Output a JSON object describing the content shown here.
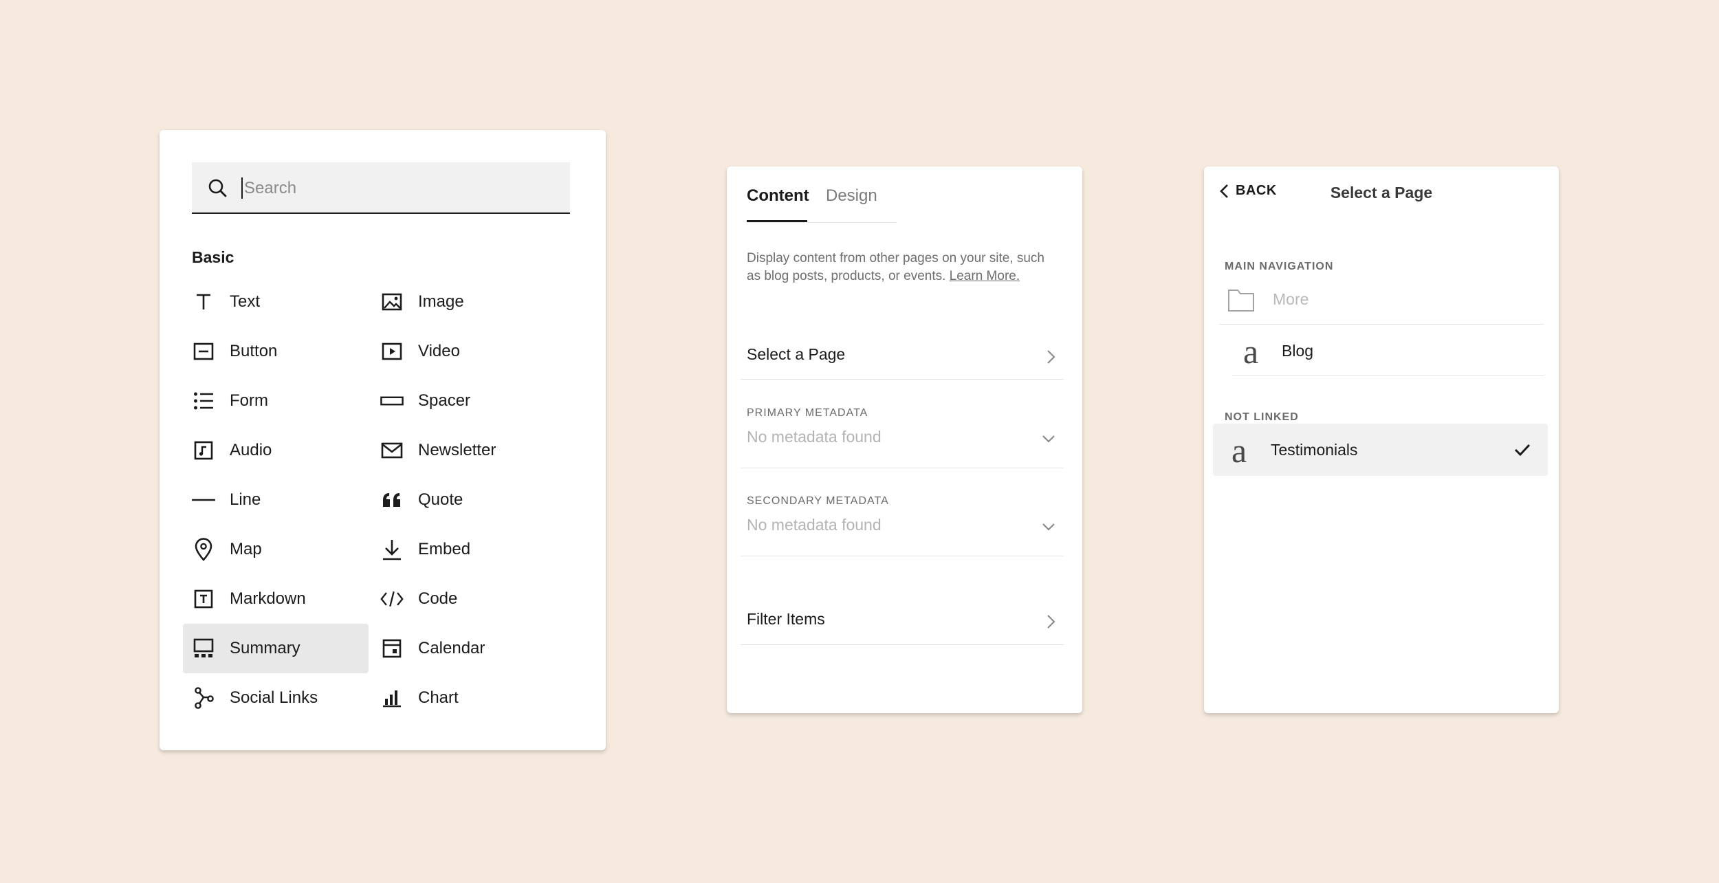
{
  "blocks_panel": {
    "search_placeholder": "Search",
    "section_title": "Basic",
    "left_column": [
      {
        "label": "Text",
        "icon": "text-icon"
      },
      {
        "label": "Button",
        "icon": "button-icon"
      },
      {
        "label": "Form",
        "icon": "form-icon"
      },
      {
        "label": "Audio",
        "icon": "audio-icon"
      },
      {
        "label": "Line",
        "icon": "line-icon"
      },
      {
        "label": "Map",
        "icon": "map-pin-icon"
      },
      {
        "label": "Markdown",
        "icon": "markdown-icon"
      },
      {
        "label": "Summary",
        "icon": "summary-icon",
        "selected": true
      },
      {
        "label": "Social Links",
        "icon": "social-links-icon"
      }
    ],
    "right_column": [
      {
        "label": "Image",
        "icon": "image-icon"
      },
      {
        "label": "Video",
        "icon": "video-icon"
      },
      {
        "label": "Spacer",
        "icon": "spacer-icon"
      },
      {
        "label": "Newsletter",
        "icon": "newsletter-icon"
      },
      {
        "label": "Quote",
        "icon": "quote-icon"
      },
      {
        "label": "Embed",
        "icon": "embed-icon"
      },
      {
        "label": "Code",
        "icon": "code-icon"
      },
      {
        "label": "Calendar",
        "icon": "calendar-icon"
      },
      {
        "label": "Chart",
        "icon": "chart-icon"
      }
    ]
  },
  "summary_panel": {
    "tabs": [
      {
        "label": "Content",
        "active": true
      },
      {
        "label": "Design",
        "active": false
      }
    ],
    "description": "Display content from other pages on your site, such as blog posts, products, or events.",
    "learn_more": "Learn More.",
    "select_page": "Select a Page",
    "primary_metadata": {
      "label": "PRIMARY METADATA",
      "value": "No metadata found"
    },
    "secondary_metadata": {
      "label": "SECONDARY METADATA",
      "value": "No metadata found"
    },
    "filter_items": "Filter Items"
  },
  "select_page_panel": {
    "back_label": "BACK",
    "title": "Select a Page",
    "main_navigation_label": "MAIN NAVIGATION",
    "main_navigation": [
      {
        "label": "More",
        "icon": "folder-icon",
        "disabled": true
      },
      {
        "label": "Blog",
        "icon": "blog-page-icon"
      }
    ],
    "not_linked_label": "NOT LINKED",
    "not_linked": [
      {
        "label": "Testimonials",
        "icon": "page-icon",
        "selected": true
      }
    ]
  },
  "colors": {
    "background": "#f6eadf",
    "panel": "#ffffff",
    "selected_row": "#e8e8e8",
    "text": "#1b1b1b",
    "muted": "#b3b3b3"
  }
}
